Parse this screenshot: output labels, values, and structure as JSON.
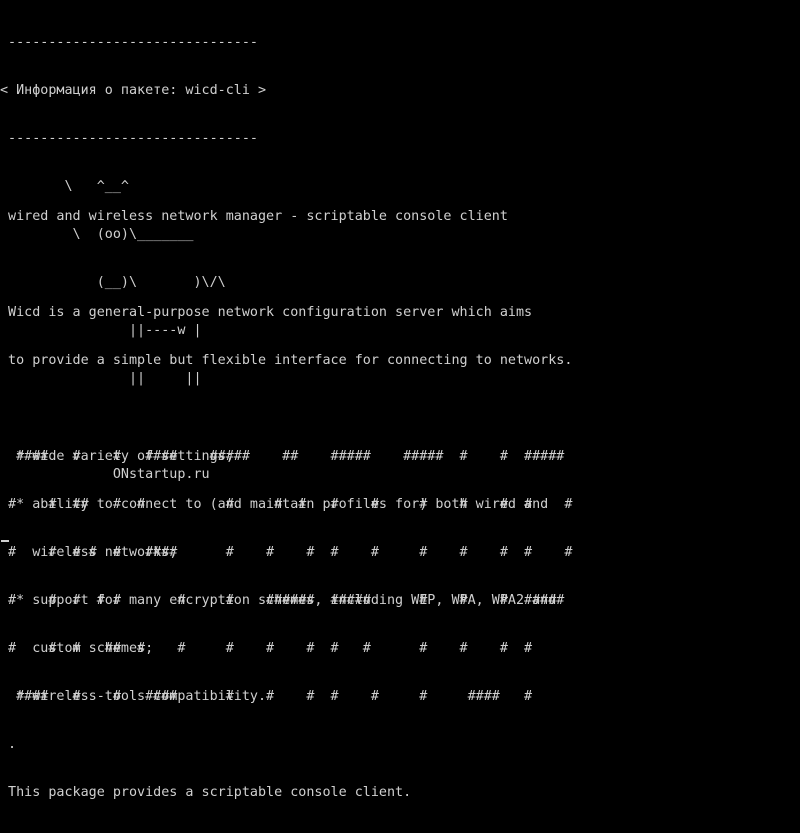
{
  "terminal": {
    "cowsay": [
      " -------------------------------",
      "< Информация о пакете: wicd-cli >",
      " -------------------------------",
      "        \\   ^__^",
      "         \\  (oo)\\_______",
      "            (__)\\       )\\/\\",
      "                ||----w |",
      "                ||     ||",
      "",
      "              ONstartup.ru"
    ],
    "description": [
      " wired and wireless network manager - scriptable console client",
      "",
      " Wicd is a general-purpose network configuration server which aims",
      " to provide a simple but flexible interface for connecting to networks.",
      "",
      "  * wide variety of settings;",
      "  * ability to connect to (and maintain profiles for) both wired and",
      "    wireless networks;",
      "  * support for many encryption schemes, including WEP, WPA, WPA2 and",
      "    custom schemes;",
      "  * wireless-tools compatibility.",
      " .",
      " This package provides a scriptable console client."
    ],
    "banner": [
      "  ####   #    #   ####    #####    ##    #####    #####  #    #  #####",
      " #    #  ##   #  #          #     #  #   #    #     #    #    #  #    #",
      " #    #  # #  #   ####      #    #    #  #    #     #    #    #  #    #",
      " #    #  #  # #       #     #    ######  #####      #    #    #  #####",
      " #    #  #   ##  #    #     #    #    #  #   #      #    #    #  #",
      "  ####   #    #   ####      #    #    #  #    #     #     ####   #"
    ]
  }
}
